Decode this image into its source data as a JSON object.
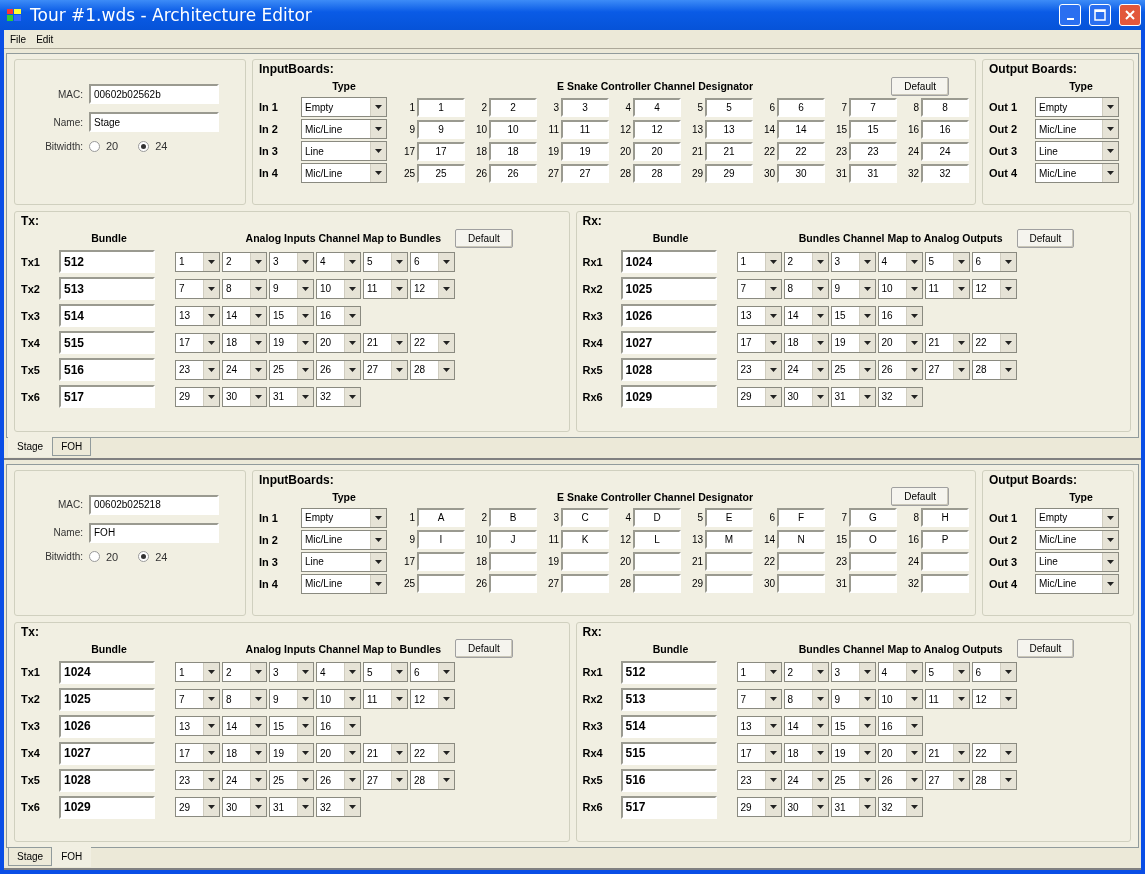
{
  "window": {
    "title": "Tour #1.wds - Architecture Editor"
  },
  "menu": [
    "File",
    "Edit"
  ],
  "panels": [
    {
      "device": {
        "mac_label": "MAC:",
        "mac": "00602b02562b",
        "name_label": "Name:",
        "name": "Stage",
        "bitwidth_label": "Bitwidth:",
        "bitwidth_options": [
          {
            "label": "20",
            "selected": false
          },
          {
            "label": "24",
            "selected": true
          }
        ]
      },
      "input_boards": {
        "title": "InputBoards:",
        "type_heading": "Type",
        "designator_heading": "E Snake Controller Channel Designator",
        "default_button": "Default",
        "rows": [
          {
            "label": "In 1",
            "type": "Empty",
            "channels": [
              {
                "number": "1",
                "value": "1"
              },
              {
                "number": "2",
                "value": "2"
              },
              {
                "number": "3",
                "value": "3"
              },
              {
                "number": "4",
                "value": "4"
              },
              {
                "number": "5",
                "value": "5"
              },
              {
                "number": "6",
                "value": "6"
              },
              {
                "number": "7",
                "value": "7"
              },
              {
                "number": "8",
                "value": "8"
              }
            ]
          },
          {
            "label": "In 2",
            "type": "Mic/Line",
            "channels": [
              {
                "number": "9",
                "value": "9"
              },
              {
                "number": "10",
                "value": "10"
              },
              {
                "number": "11",
                "value": "11"
              },
              {
                "number": "12",
                "value": "12"
              },
              {
                "number": "13",
                "value": "13"
              },
              {
                "number": "14",
                "value": "14"
              },
              {
                "number": "15",
                "value": "15"
              },
              {
                "number": "16",
                "value": "16"
              }
            ]
          },
          {
            "label": "In 3",
            "type": "Line",
            "channels": [
              {
                "number": "17",
                "value": "17"
              },
              {
                "number": "18",
                "value": "18"
              },
              {
                "number": "19",
                "value": "19"
              },
              {
                "number": "20",
                "value": "20"
              },
              {
                "number": "21",
                "value": "21"
              },
              {
                "number": "22",
                "value": "22"
              },
              {
                "number": "23",
                "value": "23"
              },
              {
                "number": "24",
                "value": "24"
              }
            ]
          },
          {
            "label": "In 4",
            "type": "Mic/Line",
            "channels": [
              {
                "number": "25",
                "value": "25"
              },
              {
                "number": "26",
                "value": "26"
              },
              {
                "number": "27",
                "value": "27"
              },
              {
                "number": "28",
                "value": "28"
              },
              {
                "number": "29",
                "value": "29"
              },
              {
                "number": "30",
                "value": "30"
              },
              {
                "number": "31",
                "value": "31"
              },
              {
                "number": "32",
                "value": "32"
              }
            ]
          }
        ]
      },
      "output_boards": {
        "title": "Output Boards:",
        "type_heading": "Type",
        "rows": [
          {
            "label": "Out 1",
            "type": "Empty"
          },
          {
            "label": "Out 2",
            "type": "Mic/Line"
          },
          {
            "label": "Out 3",
            "type": "Line"
          },
          {
            "label": "Out 4",
            "type": "Mic/Line"
          }
        ]
      },
      "tx": {
        "title": "Tx:",
        "bundle_heading": "Bundle",
        "map_heading": "Analog Inputs Channel Map to Bundles",
        "default_button": "Default",
        "rows": [
          {
            "label": "Tx1",
            "bundle": "512",
            "channels": [
              "1",
              "2",
              "3",
              "4",
              "5",
              "6"
            ]
          },
          {
            "label": "Tx2",
            "bundle": "513",
            "channels": [
              "7",
              "8",
              "9",
              "10",
              "11",
              "12"
            ]
          },
          {
            "label": "Tx3",
            "bundle": "514",
            "channels": [
              "13",
              "14",
              "15",
              "16"
            ]
          },
          {
            "label": "Tx4",
            "bundle": "515",
            "channels": [
              "17",
              "18",
              "19",
              "20",
              "21",
              "22"
            ]
          },
          {
            "label": "Tx5",
            "bundle": "516",
            "channels": [
              "23",
              "24",
              "25",
              "26",
              "27",
              "28"
            ]
          },
          {
            "label": "Tx6",
            "bundle": "517",
            "channels": [
              "29",
              "30",
              "31",
              "32"
            ]
          }
        ]
      },
      "rx": {
        "title": "Rx:",
        "bundle_heading": "Bundle",
        "map_heading": "Bundles Channel Map to Analog Outputs",
        "default_button": "Default",
        "rows": [
          {
            "label": "Rx1",
            "bundle": "1024",
            "channels": [
              "1",
              "2",
              "3",
              "4",
              "5",
              "6"
            ]
          },
          {
            "label": "Rx2",
            "bundle": "1025",
            "channels": [
              "7",
              "8",
              "9",
              "10",
              "11",
              "12"
            ]
          },
          {
            "label": "Rx3",
            "bundle": "1026",
            "channels": [
              "13",
              "14",
              "15",
              "16"
            ]
          },
          {
            "label": "Rx4",
            "bundle": "1027",
            "channels": [
              "17",
              "18",
              "19",
              "20",
              "21",
              "22"
            ]
          },
          {
            "label": "Rx5",
            "bundle": "1028",
            "channels": [
              "23",
              "24",
              "25",
              "26",
              "27",
              "28"
            ]
          },
          {
            "label": "Rx6",
            "bundle": "1029",
            "channels": [
              "29",
              "30",
              "31",
              "32"
            ]
          }
        ]
      },
      "tabs": [
        {
          "label": "Stage",
          "selected": true
        },
        {
          "label": "FOH",
          "selected": false
        }
      ]
    },
    {
      "device": {
        "mac_label": "MAC:",
        "mac": "00602b025218",
        "name_label": "Name:",
        "name": "FOH",
        "bitwidth_label": "Bitwidth:",
        "bitwidth_options": [
          {
            "label": "20",
            "selected": false
          },
          {
            "label": "24",
            "selected": true
          }
        ]
      },
      "input_boards": {
        "title": "InputBoards:",
        "type_heading": "Type",
        "designator_heading": "E Snake Controller Channel Designator",
        "default_button": "Default",
        "rows": [
          {
            "label": "In 1",
            "type": "Empty",
            "channels": [
              {
                "number": "1",
                "value": "A"
              },
              {
                "number": "2",
                "value": "B"
              },
              {
                "number": "3",
                "value": "C"
              },
              {
                "number": "4",
                "value": "D"
              },
              {
                "number": "5",
                "value": "E"
              },
              {
                "number": "6",
                "value": "F"
              },
              {
                "number": "7",
                "value": "G"
              },
              {
                "number": "8",
                "value": "H"
              }
            ]
          },
          {
            "label": "In 2",
            "type": "Mic/Line",
            "channels": [
              {
                "number": "9",
                "value": "I"
              },
              {
                "number": "10",
                "value": "J"
              },
              {
                "number": "11",
                "value": "K"
              },
              {
                "number": "12",
                "value": "L"
              },
              {
                "number": "13",
                "value": "M"
              },
              {
                "number": "14",
                "value": "N"
              },
              {
                "number": "15",
                "value": "O"
              },
              {
                "number": "16",
                "value": "P"
              }
            ]
          },
          {
            "label": "In 3",
            "type": "Line",
            "channels": [
              {
                "number": "17"
              },
              {
                "number": "18"
              },
              {
                "number": "19"
              },
              {
                "number": "20"
              },
              {
                "number": "21"
              },
              {
                "number": "22"
              },
              {
                "number": "23"
              },
              {
                "number": "24"
              }
            ]
          },
          {
            "label": "In 4",
            "type": "Mic/Line",
            "channels": [
              {
                "number": "25"
              },
              {
                "number": "26"
              },
              {
                "number": "27"
              },
              {
                "number": "28"
              },
              {
                "number": "29"
              },
              {
                "number": "30"
              },
              {
                "number": "31"
              },
              {
                "number": "32"
              }
            ]
          }
        ]
      },
      "output_boards": {
        "title": "Output Boards:",
        "type_heading": "Type",
        "rows": [
          {
            "label": "Out 1",
            "type": "Empty"
          },
          {
            "label": "Out 2",
            "type": "Mic/Line"
          },
          {
            "label": "Out 3",
            "type": "Line"
          },
          {
            "label": "Out 4",
            "type": "Mic/Line"
          }
        ]
      },
      "tx": {
        "title": "Tx:",
        "bundle_heading": "Bundle",
        "map_heading": "Analog Inputs Channel Map to Bundles",
        "default_button": "Default",
        "rows": [
          {
            "label": "Tx1",
            "bundle": "1024",
            "channels": [
              "1",
              "2",
              "3",
              "4",
              "5",
              "6"
            ]
          },
          {
            "label": "Tx2",
            "bundle": "1025",
            "channels": [
              "7",
              "8",
              "9",
              "10",
              "11",
              "12"
            ]
          },
          {
            "label": "Tx3",
            "bundle": "1026",
            "channels": [
              "13",
              "14",
              "15",
              "16"
            ]
          },
          {
            "label": "Tx4",
            "bundle": "1027",
            "channels": [
              "17",
              "18",
              "19",
              "20",
              "21",
              "22"
            ]
          },
          {
            "label": "Tx5",
            "bundle": "1028",
            "channels": [
              "23",
              "24",
              "25",
              "26",
              "27",
              "28"
            ]
          },
          {
            "label": "Tx6",
            "bundle": "1029",
            "channels": [
              "29",
              "30",
              "31",
              "32"
            ]
          }
        ]
      },
      "rx": {
        "title": "Rx:",
        "bundle_heading": "Bundle",
        "map_heading": "Bundles Channel Map to Analog Outputs",
        "default_button": "Default",
        "rows": [
          {
            "label": "Rx1",
            "bundle": "512",
            "channels": [
              "1",
              "2",
              "3",
              "4",
              "5",
              "6"
            ]
          },
          {
            "label": "Rx2",
            "bundle": "513",
            "channels": [
              "7",
              "8",
              "9",
              "10",
              "11",
              "12"
            ]
          },
          {
            "label": "Rx3",
            "bundle": "514",
            "channels": [
              "13",
              "14",
              "15",
              "16"
            ]
          },
          {
            "label": "Rx4",
            "bundle": "515",
            "channels": [
              "17",
              "18",
              "19",
              "20",
              "21",
              "22"
            ]
          },
          {
            "label": "Rx5",
            "bundle": "516",
            "channels": [
              "23",
              "24",
              "25",
              "26",
              "27",
              "28"
            ]
          },
          {
            "label": "Rx6",
            "bundle": "517",
            "channels": [
              "29",
              "30",
              "31",
              "32"
            ]
          }
        ]
      },
      "tabs": [
        {
          "label": "Stage",
          "selected": false
        },
        {
          "label": "FOH",
          "selected": true
        }
      ]
    }
  ]
}
